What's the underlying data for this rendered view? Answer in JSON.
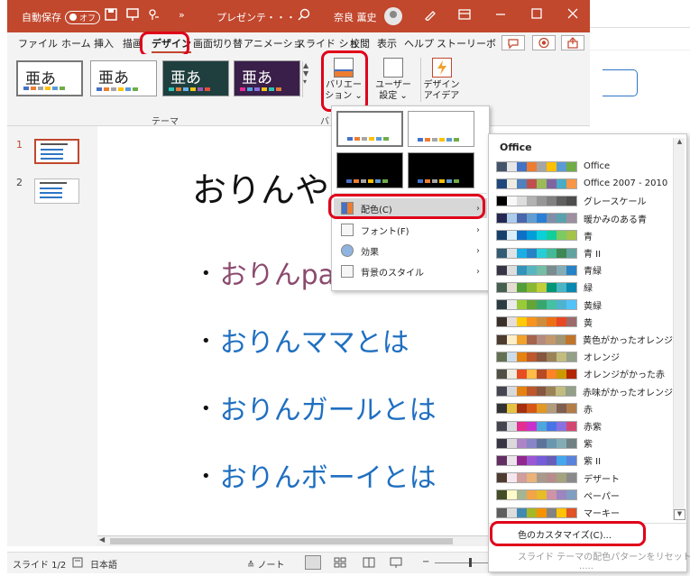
{
  "titlebar": {
    "autosave_label": "自動保存",
    "autosave_toggle": "オフ",
    "more": "»",
    "filename": "プレゼンテ・・・",
    "username": "奈良 薫史"
  },
  "tabs": [
    "ファイル",
    "ホーム",
    "挿入",
    "描画",
    "デザイン",
    "画面切り替",
    "アニメーショ",
    "スライド ショ",
    "校閲",
    "表示",
    "ヘルプ",
    "ストーリーボ"
  ],
  "ribbon": {
    "themes": [
      {
        "label": "亜あ",
        "bg": "#ffffff",
        "fg": "#222222"
      },
      {
        "label": "亜あ",
        "bg": "#ffffff",
        "fg": "#222222"
      },
      {
        "label": "亜あ",
        "bg": "#1f3f3f",
        "fg": "#ffffff"
      },
      {
        "label": "亜あ",
        "bg": "#3a1f4a",
        "fg": "#ffffff"
      }
    ],
    "theme_group_label": "テーマ",
    "variation_label1": "バリエー",
    "variation_label2": "ション",
    "group_frag": "バ",
    "user_settings1": "ユーザー",
    "user_settings2": "設定",
    "design_ideas1": "デザイン",
    "design_ideas2": "アイデア"
  },
  "slides": {
    "nums": [
      "1",
      "2"
    ]
  },
  "slide": {
    "title": "おりんや",
    "bullets": [
      {
        "dot": "•",
        "text": "おりんpa",
        "color": "#8b4a6e"
      },
      {
        "dot": "•",
        "text": "おりんママとは",
        "color": "#1f6fc0"
      },
      {
        "dot": "•",
        "text": "おりんガールとは",
        "color": "#1f6fc0"
      },
      {
        "dot": "•",
        "text": "おりんボーイとは",
        "color": "#1f6fc0"
      }
    ]
  },
  "statusbar": {
    "slide_count": "スライド 1/2",
    "language": "日本語",
    "notes": "ノート"
  },
  "variants_menu": {
    "items": [
      {
        "label": "配色(C)",
        "arrow": "›"
      },
      {
        "label": "フォント(F)",
        "arrow": "›"
      },
      {
        "label": "効果",
        "arrow": "›"
      },
      {
        "label": "背景のスタイル",
        "arrow": "›"
      }
    ]
  },
  "colors_menu": {
    "header": "Office",
    "schemes": [
      {
        "name": "Office",
        "colors": [
          "#44546a",
          "#e7e6e6",
          "#4472c4",
          "#ed7d31",
          "#a5a5a5",
          "#ffc000",
          "#5b9bd5",
          "#70ad47"
        ]
      },
      {
        "name": "Office 2007 - 2010",
        "colors": [
          "#1f497d",
          "#eeece1",
          "#4f81bd",
          "#c0504d",
          "#9bbb59",
          "#8064a2",
          "#4bacc6",
          "#f79646"
        ]
      },
      {
        "name": "グレースケール",
        "colors": [
          "#000000",
          "#f8f8f8",
          "#dddddd",
          "#b2b2b2",
          "#969696",
          "#808080",
          "#5f5f5f",
          "#4d4d4d"
        ]
      },
      {
        "name": "暖かみのある青",
        "colors": [
          "#242852",
          "#acccea",
          "#4a66ac",
          "#629dd1",
          "#297fd5",
          "#7f8fa9",
          "#5aa2ae",
          "#9d90a0"
        ]
      },
      {
        "name": "青",
        "colors": [
          "#17406d",
          "#dbeff9",
          "#0f6fc6",
          "#009dd9",
          "#0bd0d9",
          "#10cf9b",
          "#7cca62",
          "#a5c249"
        ]
      },
      {
        "name": "青 II",
        "colors": [
          "#335b74",
          "#dfe3e5",
          "#1cade4",
          "#2683c6",
          "#27ced7",
          "#42ba97",
          "#3e8853",
          "#62a39f"
        ]
      },
      {
        "name": "青緑",
        "colors": [
          "#373545",
          "#dedede",
          "#3494ba",
          "#58b6c0",
          "#75bda7",
          "#7a8c8e",
          "#84acb6",
          "#2683c6"
        ]
      },
      {
        "name": "緑",
        "colors": [
          "#455f51",
          "#e3ded1",
          "#549e39",
          "#8ab833",
          "#c0cf3a",
          "#029676",
          "#4ab5c4",
          "#0989b1"
        ]
      },
      {
        "name": "黄緑",
        "colors": [
          "#2c3c43",
          "#ebebeb",
          "#99cb38",
          "#63a537",
          "#37a76f",
          "#44c1a3",
          "#4eb3cf",
          "#51c3f9"
        ]
      },
      {
        "name": "黄",
        "colors": [
          "#39302a",
          "#e5dedb",
          "#ffca08",
          "#f8931d",
          "#ce8d3e",
          "#ec7016",
          "#e64823",
          "#9c6a6a"
        ]
      },
      {
        "name": "黄色がかったオレンジ",
        "colors": [
          "#4e3b30",
          "#fbeec9",
          "#f0a22e",
          "#a5644e",
          "#b58b80",
          "#c3986d",
          "#a19574",
          "#c17529"
        ]
      },
      {
        "name": "オレンジ",
        "colors": [
          "#637052",
          "#ccddea",
          "#e48312",
          "#bd582c",
          "#865640",
          "#9b8357",
          "#c2bc80",
          "#94a088"
        ]
      },
      {
        "name": "オレンジがかった赤",
        "colors": [
          "#505046",
          "#eeece1",
          "#e84c22",
          "#ffbd47",
          "#b64926",
          "#ff8427",
          "#cc9900",
          "#b22600"
        ]
      },
      {
        "name": "赤味がかったオレンジ",
        "colors": [
          "#454551",
          "#d8d9dc",
          "#e48312",
          "#bd582c",
          "#865640",
          "#9b8357",
          "#c2bc80",
          "#94a088"
        ]
      },
      {
        "name": "赤",
        "colors": [
          "#323232",
          "#e5c243",
          "#a5300f",
          "#d55816",
          "#e19825",
          "#b19c7d",
          "#7f5f52",
          "#b27d49"
        ]
      },
      {
        "name": "赤紫",
        "colors": [
          "#454551",
          "#d8d9dc",
          "#e32d91",
          "#c830cc",
          "#4ea6dc",
          "#4775e7",
          "#8971e1",
          "#d54773"
        ]
      },
      {
        "name": "紫",
        "colors": [
          "#373545",
          "#dcd8dc",
          "#ad84c6",
          "#8784c7",
          "#5d739a",
          "#6997af",
          "#84acb6",
          "#6f8183"
        ]
      },
      {
        "name": "紫 II",
        "colors": [
          "#632e62",
          "#eae5eb",
          "#92278f",
          "#9b57d3",
          "#755dd9",
          "#665eb8",
          "#45a5ed",
          "#5982db"
        ]
      },
      {
        "name": "デザート",
        "colors": [
          "#4e3b30",
          "#f4e7ed",
          "#d09e9e",
          "#e9b37a",
          "#a89a8a",
          "#b78d8b",
          "#a5a37f",
          "#8a8a8a"
        ]
      },
      {
        "name": "ペーパー",
        "colors": [
          "#444d26",
          "#fefac9",
          "#a5b592",
          "#f3a447",
          "#e7bc29",
          "#d092a7",
          "#9c85c0",
          "#809ec2"
        ]
      },
      {
        "name": "マーキー",
        "colors": [
          "#5e5e5e",
          "#dddddd",
          "#418ab3",
          "#a6b727",
          "#f69200",
          "#838383",
          "#fec306",
          "#df5327"
        ]
      }
    ],
    "customize": "色のカスタマイズ(C)...",
    "reset": "スライド テーマの配色パターンをリセット(R)",
    "dots": "....."
  },
  "colors": {
    "accent": "#c1472d",
    "highlight": "#e0001a"
  }
}
